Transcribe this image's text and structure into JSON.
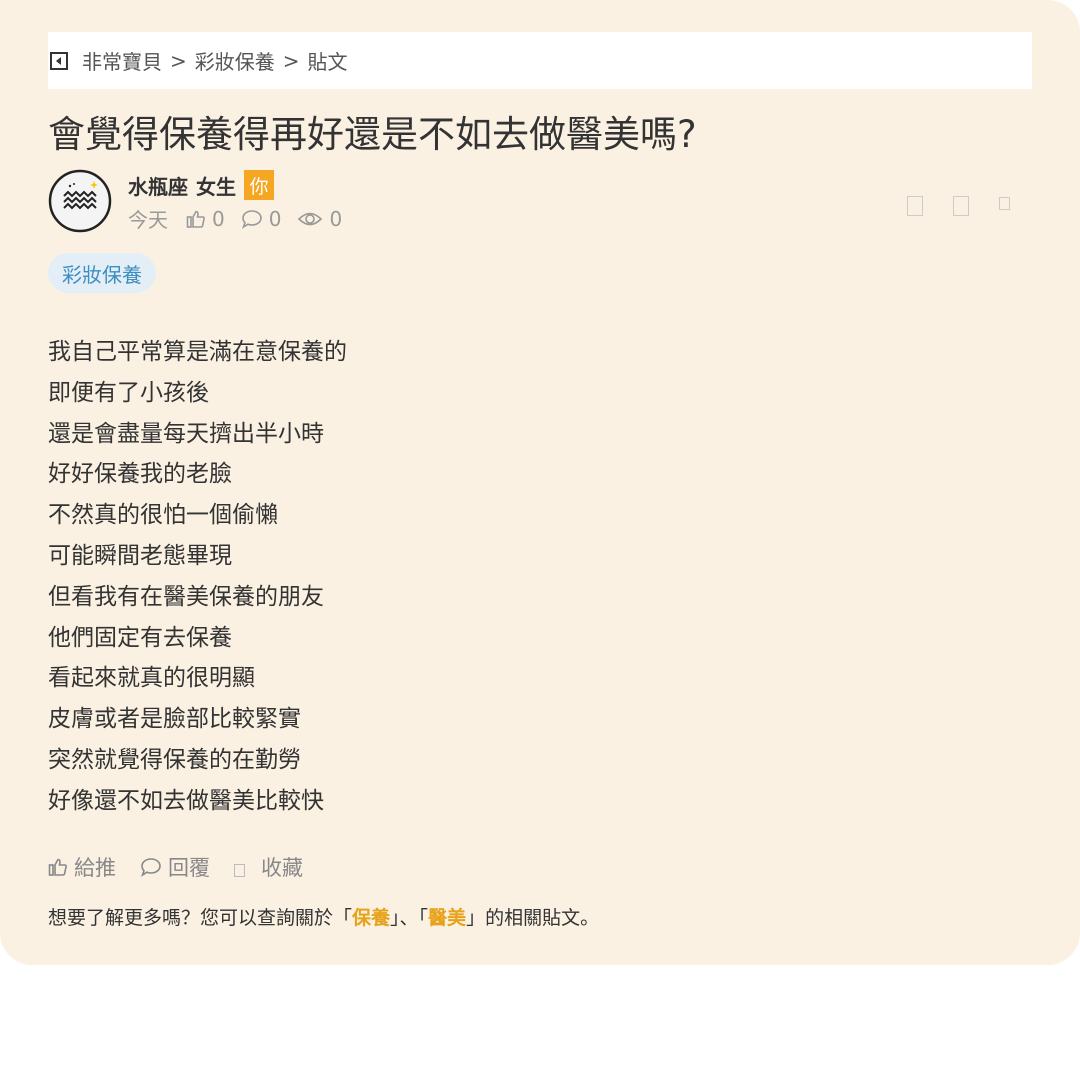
{
  "breadcrumb": {
    "items": [
      "非常寶貝",
      "彩妝保養",
      "貼文"
    ],
    "separator": ">"
  },
  "post": {
    "title": "會覺得保養得再好還是不如去做醫美嗎?",
    "author": {
      "name": "水瓶座",
      "gender": "女生",
      "badge": "你",
      "avatar_icon": "aquarius-icon"
    },
    "meta": {
      "date": "今天",
      "likes": "0",
      "comments": "0",
      "views": "0"
    },
    "tag": "彩妝保養",
    "body_lines": [
      "我自己平常算是滿在意保養的",
      "即便有了小孩後",
      "還是會盡量每天擠出半小時",
      "好好保養我的老臉",
      "不然真的很怕一個偷懶",
      "可能瞬間老態畢現",
      "但看我有在醫美保養的朋友",
      "他們固定有去保養",
      "看起來就真的很明顯",
      "皮膚或者是臉部比較緊實",
      "突然就覺得保養的在勤勞",
      "好像還不如去做醫美比較快"
    ]
  },
  "actions": {
    "like_label": "給推",
    "reply_label": "回覆",
    "bookmark_label": "收藏"
  },
  "related": {
    "prefix": "想要了解更多嗎？您可以查詢關於「",
    "keyword1": "保養",
    "middle": "」、「",
    "keyword2": "醫美",
    "suffix": "」的相關貼文。"
  },
  "colors": {
    "card_bg": "#faf1e3",
    "accent_orange": "#f5a623",
    "keyword_orange": "#e7a21a",
    "tag_bg": "#e3eef7",
    "tag_text": "#3d8fbf"
  }
}
